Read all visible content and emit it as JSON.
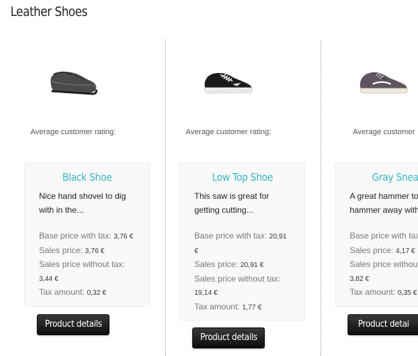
{
  "category": {
    "title": "Leather Shoes"
  },
  "products": [
    {
      "image_icon": "dark-leather-loafer-icon",
      "rating_label": "Average customer rating:",
      "name": "Black Shoe",
      "description": "Nice hand shovel to dig with in the...",
      "base_price_label": "Base price with tax:",
      "base_price": "3,76 €",
      "sales_price_label": "Sales price:",
      "sales_price": "3,76 €",
      "sales_no_tax_label": "Sales price without tax:",
      "sales_no_tax": "3,44 €",
      "tax_label": "Tax amount:",
      "tax": "0,32 €",
      "button_label": "Product details"
    },
    {
      "image_icon": "black-skate-sneaker-icon",
      "rating_label": "Average customer rating:",
      "name": "Low Top Shoe",
      "description": "This saw is great for getting cutting...",
      "base_price_label": "Base price with tax:",
      "base_price": "20,91 €",
      "sales_price_label": "Sales price:",
      "sales_price": "20,91 €",
      "sales_no_tax_label": "Sales price without tax:",
      "sales_no_tax": "19,14 €",
      "tax_label": "Tax amount:",
      "tax": "1,77 €",
      "button_label": "Product details"
    },
    {
      "image_icon": "gray-suede-sneaker-icon",
      "rating_label": "Average customer",
      "name": "Gray Sneak",
      "description": "A great hammer to hammer away with",
      "base_price_label": "Base price with tax",
      "base_price": "",
      "sales_price_label": "Sales price:",
      "sales_price": "4,17 €",
      "sales_no_tax_label": "Sales price without",
      "sales_no_tax": "3,82 €",
      "tax_label": "Tax amount:",
      "tax": "0,35 €",
      "button_label": "Product detai"
    }
  ]
}
